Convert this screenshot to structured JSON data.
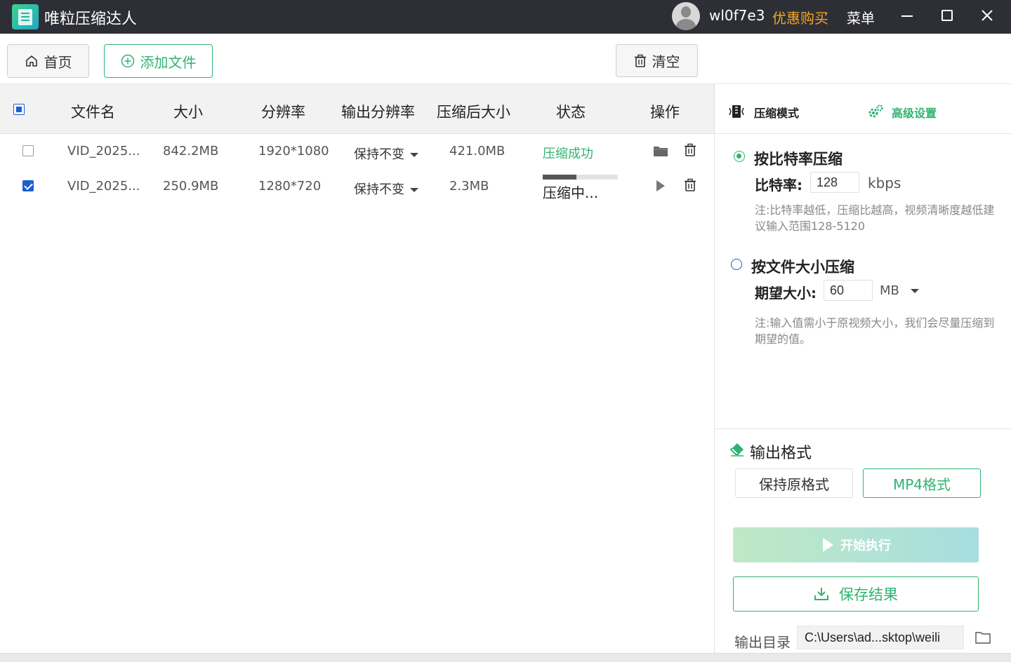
{
  "app": {
    "title": "唯粒压缩达人",
    "username": "wl0f7e3",
    "promo": "优惠购买",
    "menu": "菜单"
  },
  "toolbar": {
    "home": "首页",
    "add_file": "添加文件",
    "clear": "清空"
  },
  "table": {
    "columns": [
      "文件名",
      "大小",
      "分辨率",
      "输出分辨率",
      "压缩后大小",
      "状态",
      "操作"
    ],
    "rows": [
      {
        "checked": false,
        "name": "VID_2025...",
        "size": "842.2MB",
        "resolution": "1920*1080",
        "output_resolution": "保持不变",
        "compressed_size": "421.0MB",
        "status": "压缩成功"
      },
      {
        "checked": true,
        "name": "VID_2025...",
        "size": "250.9MB",
        "resolution": "1280*720",
        "output_resolution": "保持不变",
        "compressed_size": "2.3MB",
        "status": "压缩中...",
        "progress": 0.45
      }
    ]
  },
  "panel": {
    "tab_mode": "压缩模式",
    "tab_advanced": "高级设置",
    "bitrate_option": {
      "title": "按比特率压缩",
      "selected": true,
      "label": "比特率:",
      "value": "128",
      "unit": "kbps",
      "note": "注:比特率越低，压缩比越高，视频清晰度越低建议输入范围128-5120"
    },
    "size_option": {
      "title": "按文件大小压缩",
      "selected": false,
      "label": "期望大小:",
      "value": "60",
      "unit": "MB",
      "note": "注:输入值需小于原视频大小，我们会尽量压缩到期望的值。"
    },
    "output_format": {
      "title": "输出格式",
      "keep_original": "保持原格式",
      "mp4": "MP4格式",
      "selected": "MP4格式"
    },
    "start": "开始执行",
    "save": "保存结果",
    "output_dir_label": "输出目录",
    "output_dir": "C:\\Users\\ad...sktop\\weili"
  },
  "colors": {
    "accent": "#2fb372",
    "titlebar": "#2e2f36",
    "promo": "#f5a623",
    "checkbox": "#1a5fd0"
  }
}
